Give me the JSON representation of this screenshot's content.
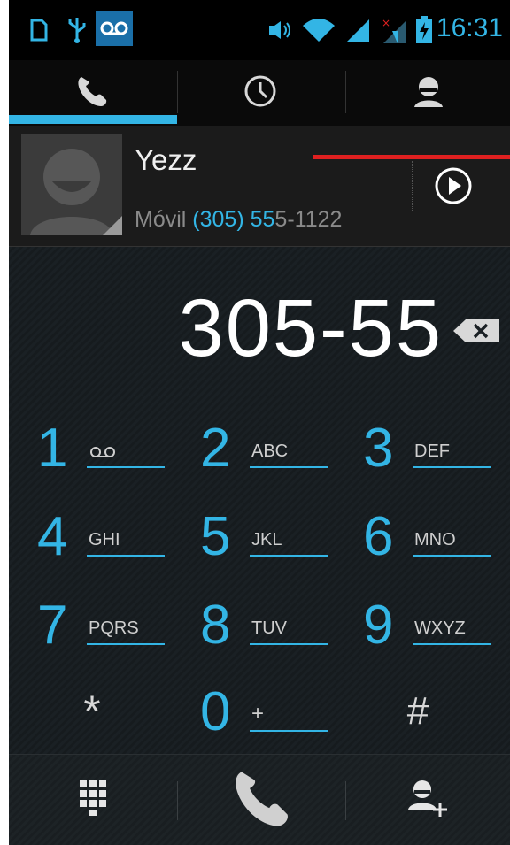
{
  "status_bar": {
    "time": "16:31",
    "icons": [
      "sim-card-icon",
      "usb-icon",
      "voicemail-icon",
      "vibrate-icon",
      "wifi-icon",
      "signal-icon",
      "no-signal-icon",
      "battery-charging-icon"
    ]
  },
  "tabs": {
    "items": [
      "phone-tab",
      "call-log-tab",
      "contacts-tab"
    ],
    "selected": "phone-tab"
  },
  "contact_suggestion": {
    "name": "Yezz",
    "number_type": "Móvil",
    "number_match": "(305) 55",
    "number_rest": "5-1122"
  },
  "dialer": {
    "entered_number": "305-55",
    "keys": [
      {
        "num": "1",
        "letters": "voicemail"
      },
      {
        "num": "2",
        "letters": "ABC"
      },
      {
        "num": "3",
        "letters": "DEF"
      },
      {
        "num": "4",
        "letters": "GHI"
      },
      {
        "num": "5",
        "letters": "JKL"
      },
      {
        "num": "6",
        "letters": "MNO"
      },
      {
        "num": "7",
        "letters": "PQRS"
      },
      {
        "num": "8",
        "letters": "TUV"
      },
      {
        "num": "9",
        "letters": "WXYZ"
      },
      {
        "num": "*",
        "letters": ""
      },
      {
        "num": "0",
        "letters": "+"
      },
      {
        "num": "#",
        "letters": ""
      }
    ]
  },
  "colors": {
    "accent": "#33b5e5",
    "red_line": "#e02020",
    "background": "#0c0c0c"
  }
}
